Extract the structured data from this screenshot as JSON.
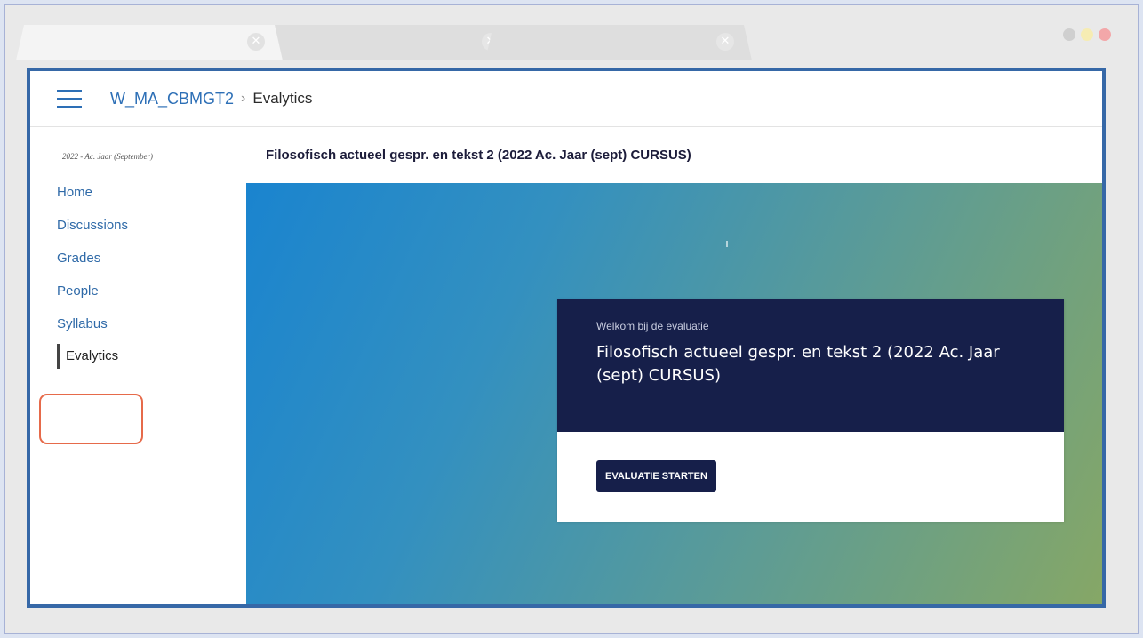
{
  "browser": {
    "tabs": [
      {
        "close_glyph": "✕",
        "active": true
      },
      {
        "close_glyph": "✕",
        "active": false
      },
      {
        "close_glyph": "✕",
        "active": false
      }
    ],
    "window_dots": [
      {
        "name": "minimize",
        "color": "#cfcfcf"
      },
      {
        "name": "maximize",
        "color": "#f6ecb3"
      },
      {
        "name": "close",
        "color": "#f3a7a9"
      }
    ]
  },
  "header": {
    "menu_icon": "hamburger-menu-icon",
    "breadcrumb": {
      "course": "W_MA_CBMGT2",
      "separator": "›",
      "current": "Evalytics"
    }
  },
  "sidebar": {
    "term": "2022 - Ac. Jaar (September)",
    "items": [
      {
        "label": "Home"
      },
      {
        "label": "Discussions"
      },
      {
        "label": "Grades"
      },
      {
        "label": "People"
      },
      {
        "label": "Syllabus"
      },
      {
        "label": "Evalytics",
        "active": true
      }
    ],
    "highlight_color": "#e66a4a"
  },
  "main": {
    "course_title": "Filosofisch actueel gespr. en tekst 2 (2022 Ac. Jaar (sept) CURSUS)",
    "card": {
      "welcome": "Welkom bij de evaluatie",
      "title": "Filosofisch actueel gespr. en tekst 2 (2022 Ac. Jaar (sept) CURSUS)",
      "button_label": "EVALUATIE STARTEN"
    }
  },
  "colors": {
    "accent": "#2d6fb6",
    "window_border": "#3668a7",
    "card_dark": "#161f4a"
  }
}
